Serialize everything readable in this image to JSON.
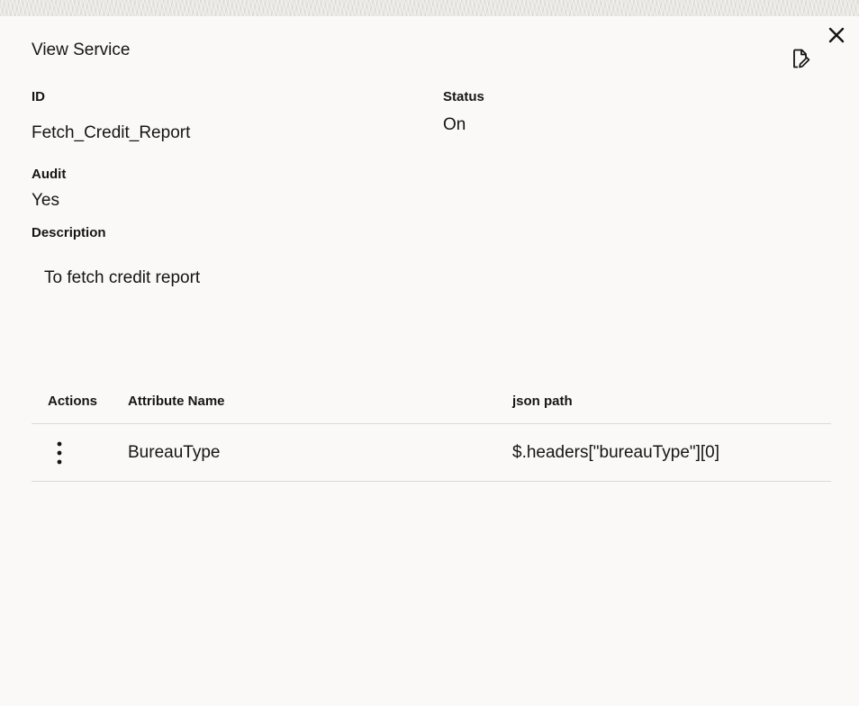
{
  "dialog": {
    "title": "View Service",
    "close_icon": "close-icon",
    "edit_icon": "document-edit-icon"
  },
  "fields": {
    "id_label": "ID",
    "id_value": "Fetch_Credit_Report",
    "status_label": "Status",
    "status_value": "On",
    "audit_label": "Audit",
    "audit_value": "Yes",
    "description_label": "Description",
    "description_value": "To fetch credit report"
  },
  "table": {
    "headers": [
      "Actions",
      "Attribute Name",
      "json path"
    ],
    "rows": [
      {
        "actions_icon": "more-vertical-icon",
        "attribute_name": "BureauType",
        "json_path": "$.headers[\"bureauType\"][0]"
      }
    ]
  }
}
